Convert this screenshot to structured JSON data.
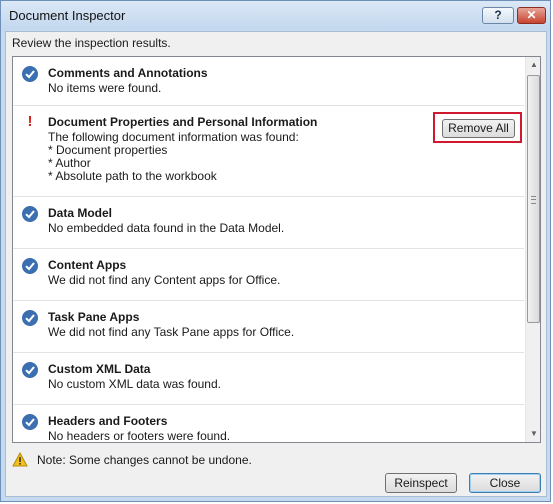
{
  "window": {
    "title": "Document Inspector",
    "help_label": "?",
    "close_label": "✕"
  },
  "header": {
    "review_text": "Review the inspection results."
  },
  "results": {
    "items": [
      {
        "status": "ok",
        "title": "Comments and Annotations",
        "lines": [
          "No items were found."
        ]
      },
      {
        "status": "warning",
        "title": "Document Properties and Personal Information",
        "lines": [
          "The following document information was found:",
          "* Document properties",
          "* Author",
          "* Absolute path to the workbook"
        ],
        "action_label": "Remove All"
      },
      {
        "status": "ok",
        "title": "Data Model",
        "lines": [
          "No embedded data found in the Data Model."
        ]
      },
      {
        "status": "ok",
        "title": "Content Apps",
        "lines": [
          "We did not find any Content apps for Office."
        ]
      },
      {
        "status": "ok",
        "title": "Task Pane Apps",
        "lines": [
          "We did not find any Task Pane apps for Office."
        ]
      },
      {
        "status": "ok",
        "title": "Custom XML Data",
        "lines": [
          "No custom XML data was found."
        ]
      },
      {
        "status": "ok",
        "title": "Headers and Footers",
        "lines": [
          "No headers or footers were found."
        ]
      }
    ]
  },
  "footer": {
    "note": "Note: Some changes cannot be undone.",
    "reinspect_label": "Reinspect",
    "close_label": "Close"
  },
  "colors": {
    "check_blue": "#3b6fb0",
    "warning_red": "#d4231c",
    "highlight_red": "#d0182e"
  }
}
